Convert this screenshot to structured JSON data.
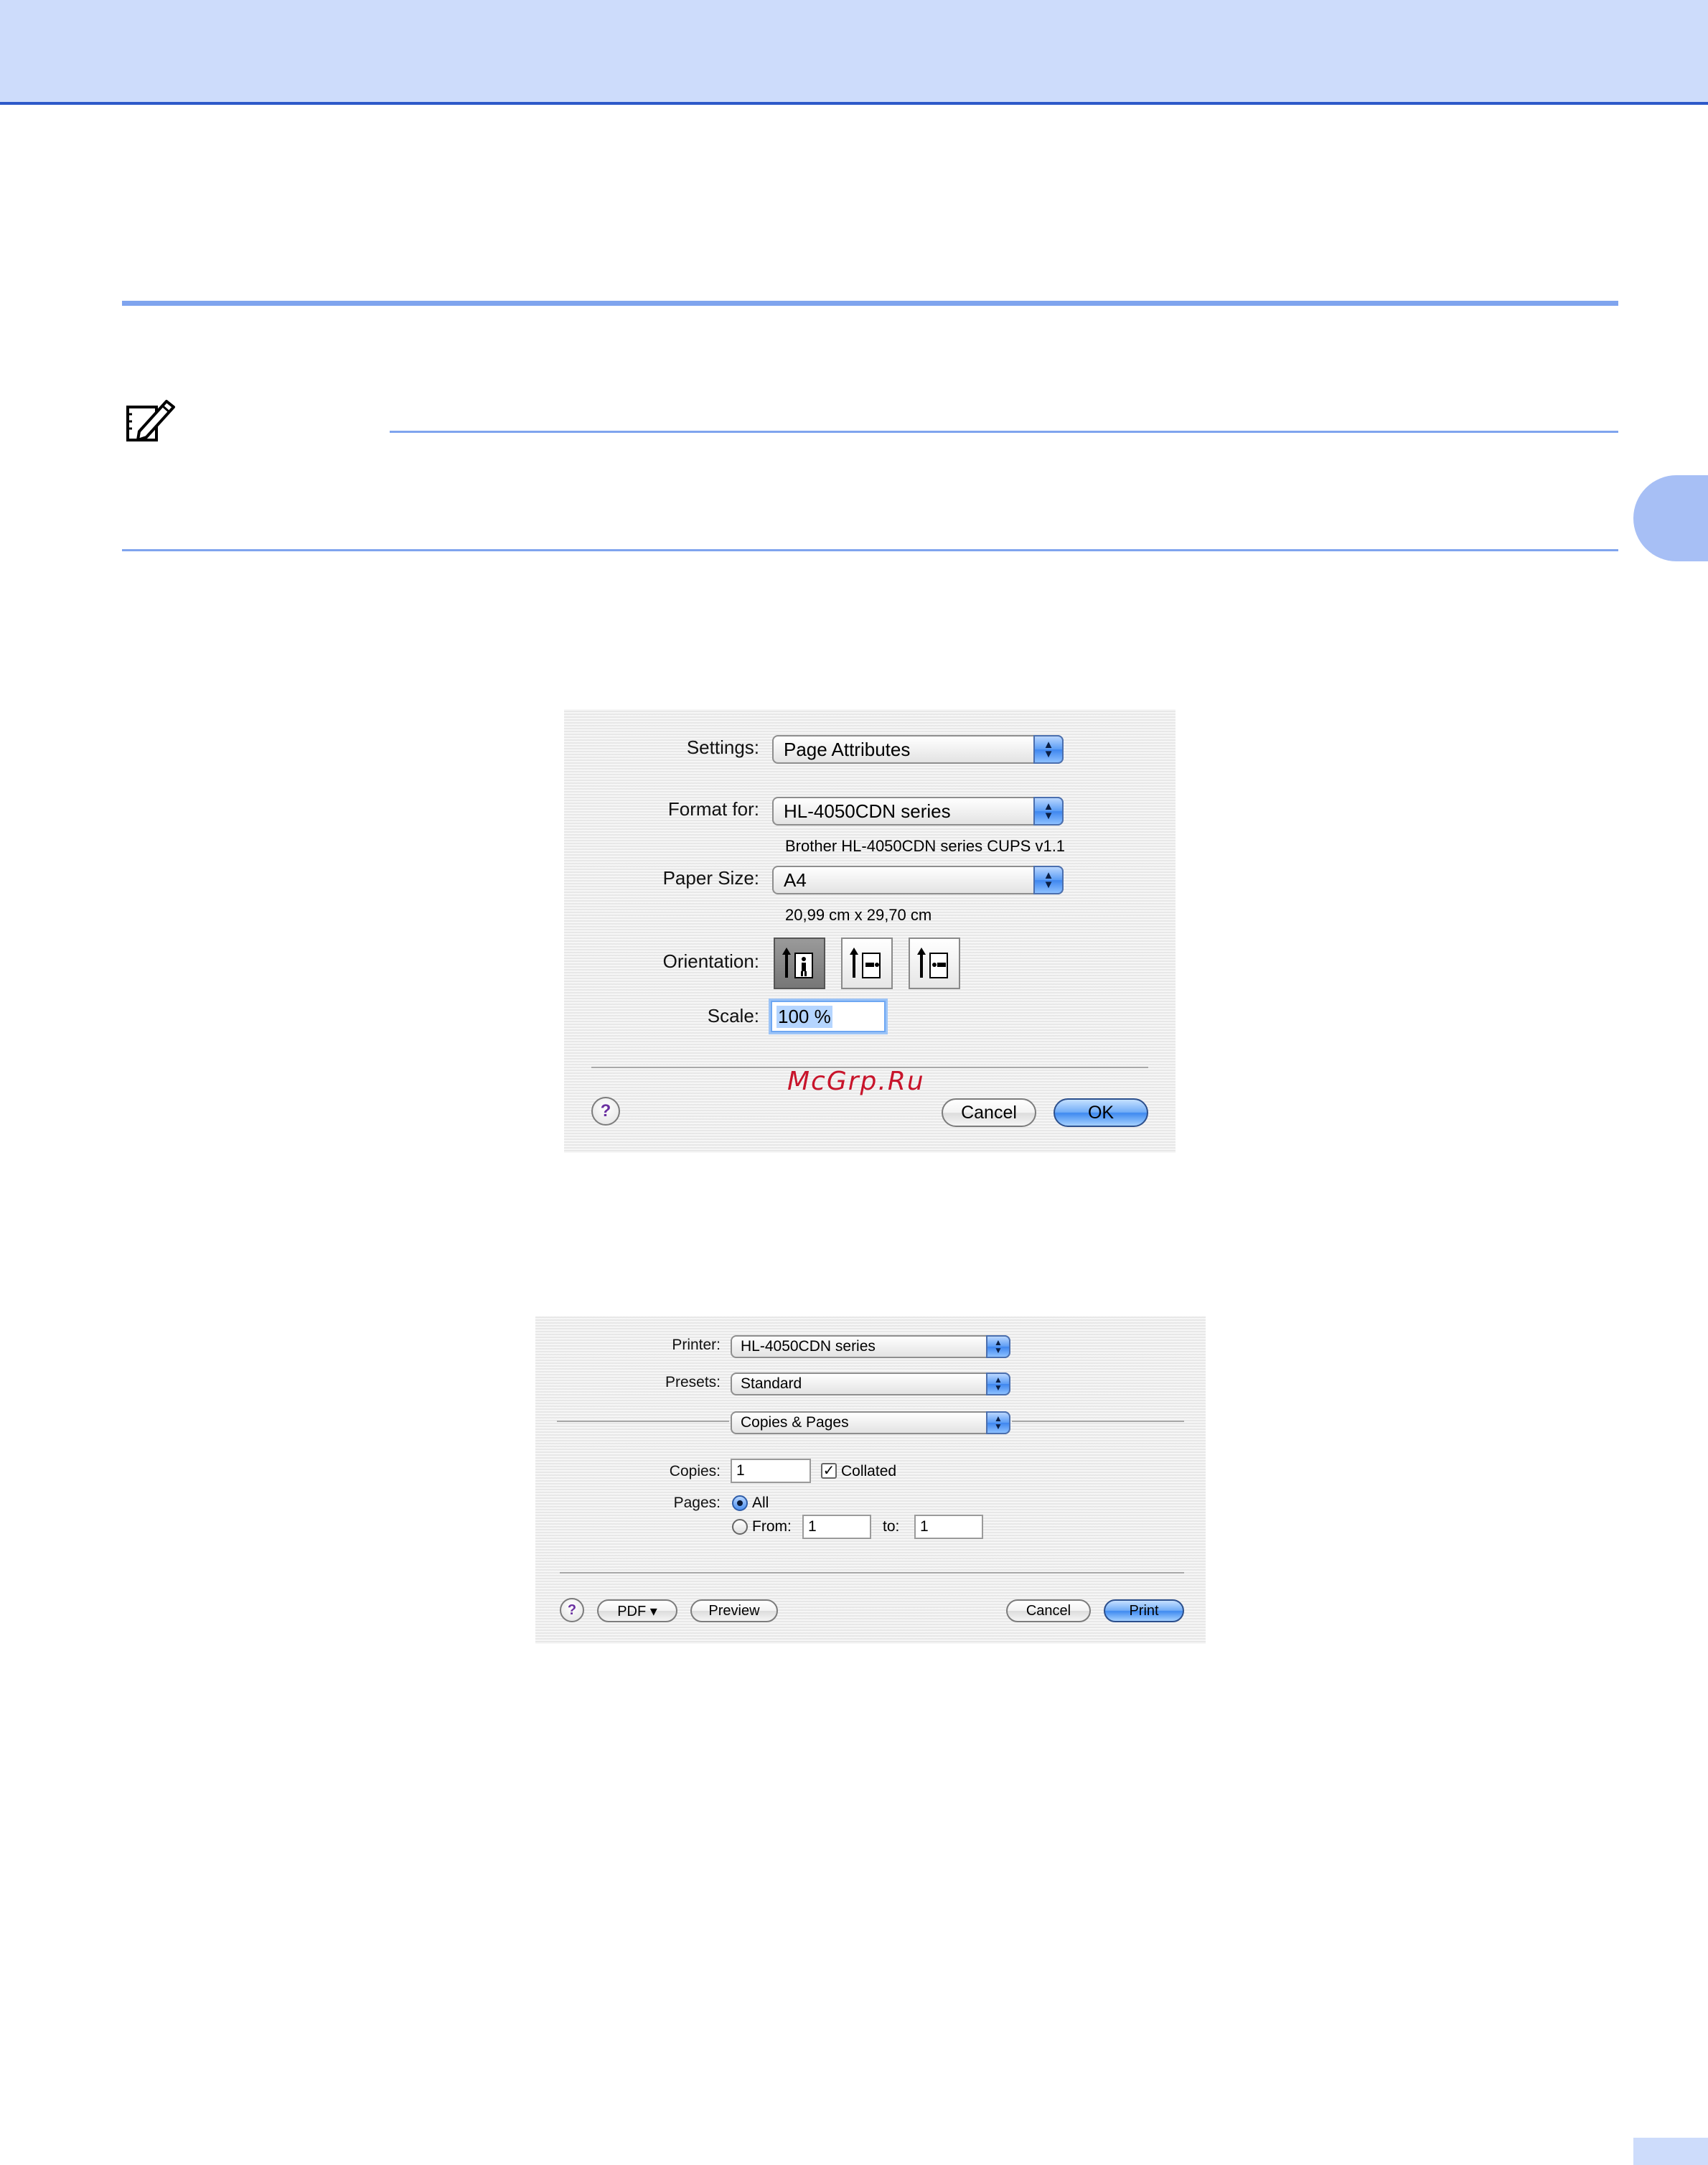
{
  "page_setup": {
    "settings": {
      "label": "Settings:",
      "value": "Page Attributes"
    },
    "format_for": {
      "label": "Format for:",
      "value": "HL-4050CDN series",
      "description": "Brother HL-4050CDN series CUPS v1.1"
    },
    "paper_size": {
      "label": "Paper Size:",
      "value": "A4",
      "dimensions": "20,99 cm x 29,70 cm"
    },
    "orientation": {
      "label": "Orientation:",
      "options": [
        "portrait",
        "landscape",
        "reverse-landscape"
      ],
      "selected": "portrait"
    },
    "scale": {
      "label": "Scale:",
      "value": "100 %"
    },
    "help": "?",
    "cancel_label": "Cancel",
    "ok_label": "OK"
  },
  "watermark": "McGrp.Ru",
  "print_dialog": {
    "printer": {
      "label": "Printer:",
      "value": "HL-4050CDN series"
    },
    "presets": {
      "label": "Presets:",
      "value": "Standard"
    },
    "panel": {
      "value": "Copies & Pages"
    },
    "copies": {
      "label": "Copies:",
      "value": "1",
      "collated_label": "Collated",
      "collated_checked": true
    },
    "pages": {
      "label": "Pages:",
      "all_label": "All",
      "from_label": "From:",
      "from_value": "1",
      "to_label": "to:",
      "to_value": "1",
      "selected": "All"
    },
    "help": "?",
    "pdf_label": "PDF ▾",
    "preview_label": "Preview",
    "cancel_label": "Cancel",
    "print_label": "Print"
  },
  "colors": {
    "banner": "#cddcfb",
    "accent_rule": "#7fa4ee",
    "chapter_tab": "#a7bff5",
    "default_button": "#3f8af0",
    "watermark": "#c8142b"
  }
}
